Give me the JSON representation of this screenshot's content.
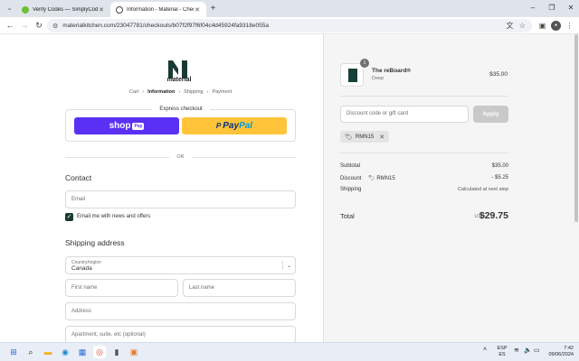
{
  "browser": {
    "tabs": [
      {
        "title": "Verify Codes — SimplyCodes",
        "active": false
      },
      {
        "title": "Information - Material - Checkout",
        "active": true
      }
    ],
    "url": "materialkitchen.com/23047781/checkouts/b07f2f97f6f04c4d45924fa9318e055a",
    "new_tab_symbol": "+"
  },
  "checkout": {
    "brand": "material",
    "breadcrumbs": [
      "Cart",
      "Information",
      "Shipping",
      "Payment"
    ],
    "breadcrumb_current": "Information",
    "express_title": "Express checkout",
    "shoppay_label": "shop",
    "shoppay_badge": "Pay",
    "paypal_label_1": "Pay",
    "paypal_label_2": "Pal",
    "or_label": "OR",
    "contact_heading": "Contact",
    "email_placeholder": "Email",
    "email_news_label": "Email me with news and offers",
    "email_news_checked": true,
    "shipping_heading": "Shipping address",
    "country_label": "Country/region",
    "country_value": "Canada",
    "first_name_placeholder": "First name",
    "last_name_placeholder": "Last name",
    "address_placeholder": "Address",
    "apartment_placeholder": "Apartment, suite, etc (optional)"
  },
  "summary": {
    "product": {
      "name": "The reBoard®",
      "variant": "Deep",
      "price": "$35.00",
      "quantity": "1"
    },
    "discount_placeholder": "Discount code or gift card",
    "apply_label": "Apply",
    "applied_code": "RMN15",
    "subtotal_label": "Subtotal",
    "subtotal_value": "$35.00",
    "discount_label": "Discount",
    "discount_code": "RMN15",
    "discount_value": "- $5.25",
    "shipping_label": "Shipping",
    "shipping_value": "Calculated at next step",
    "total_label": "Total",
    "total_currency": "USD",
    "total_value": "$29.75"
  },
  "taskbar": {
    "lang_top": "ESP",
    "lang_bottom": "ES",
    "time": "7:42",
    "date": "09/06/2024"
  },
  "colors": {
    "shoppay": "#5a31f4",
    "paypal": "#ffc439",
    "checkbox": "#1a3a34",
    "apply_disabled": "#c9c9c9",
    "summary_bg": "#f5f5f5"
  }
}
